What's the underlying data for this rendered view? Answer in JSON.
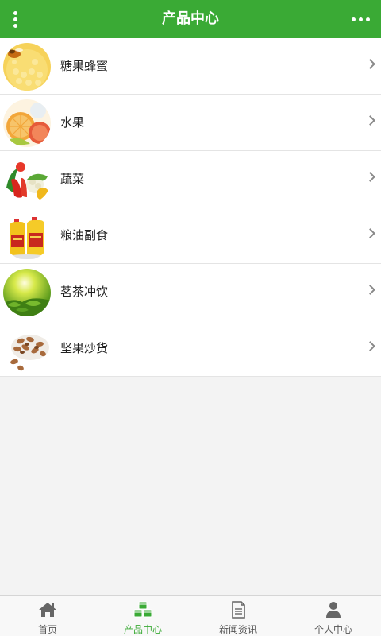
{
  "header": {
    "title": "产品中心",
    "menu_left_icon": "vertical-dots-icon",
    "menu_right_icon": "horizontal-dots-icon",
    "color": "#3aaa35"
  },
  "categories": [
    {
      "label": "糖果蜂蜜"
    },
    {
      "label": "水果"
    },
    {
      "label": "蔬菜"
    },
    {
      "label": "粮油副食"
    },
    {
      "label": "茗茶冲饮"
    },
    {
      "label": "坚果炒货"
    }
  ],
  "tabbar": {
    "tabs": [
      {
        "label": "首页",
        "icon": "home-icon"
      },
      {
        "label": "产品中心",
        "icon": "cubes-icon",
        "active": true
      },
      {
        "label": "新闻资讯",
        "icon": "document-icon"
      },
      {
        "label": "个人中心",
        "icon": "user-icon"
      }
    ],
    "active_color": "#3aaa35"
  }
}
